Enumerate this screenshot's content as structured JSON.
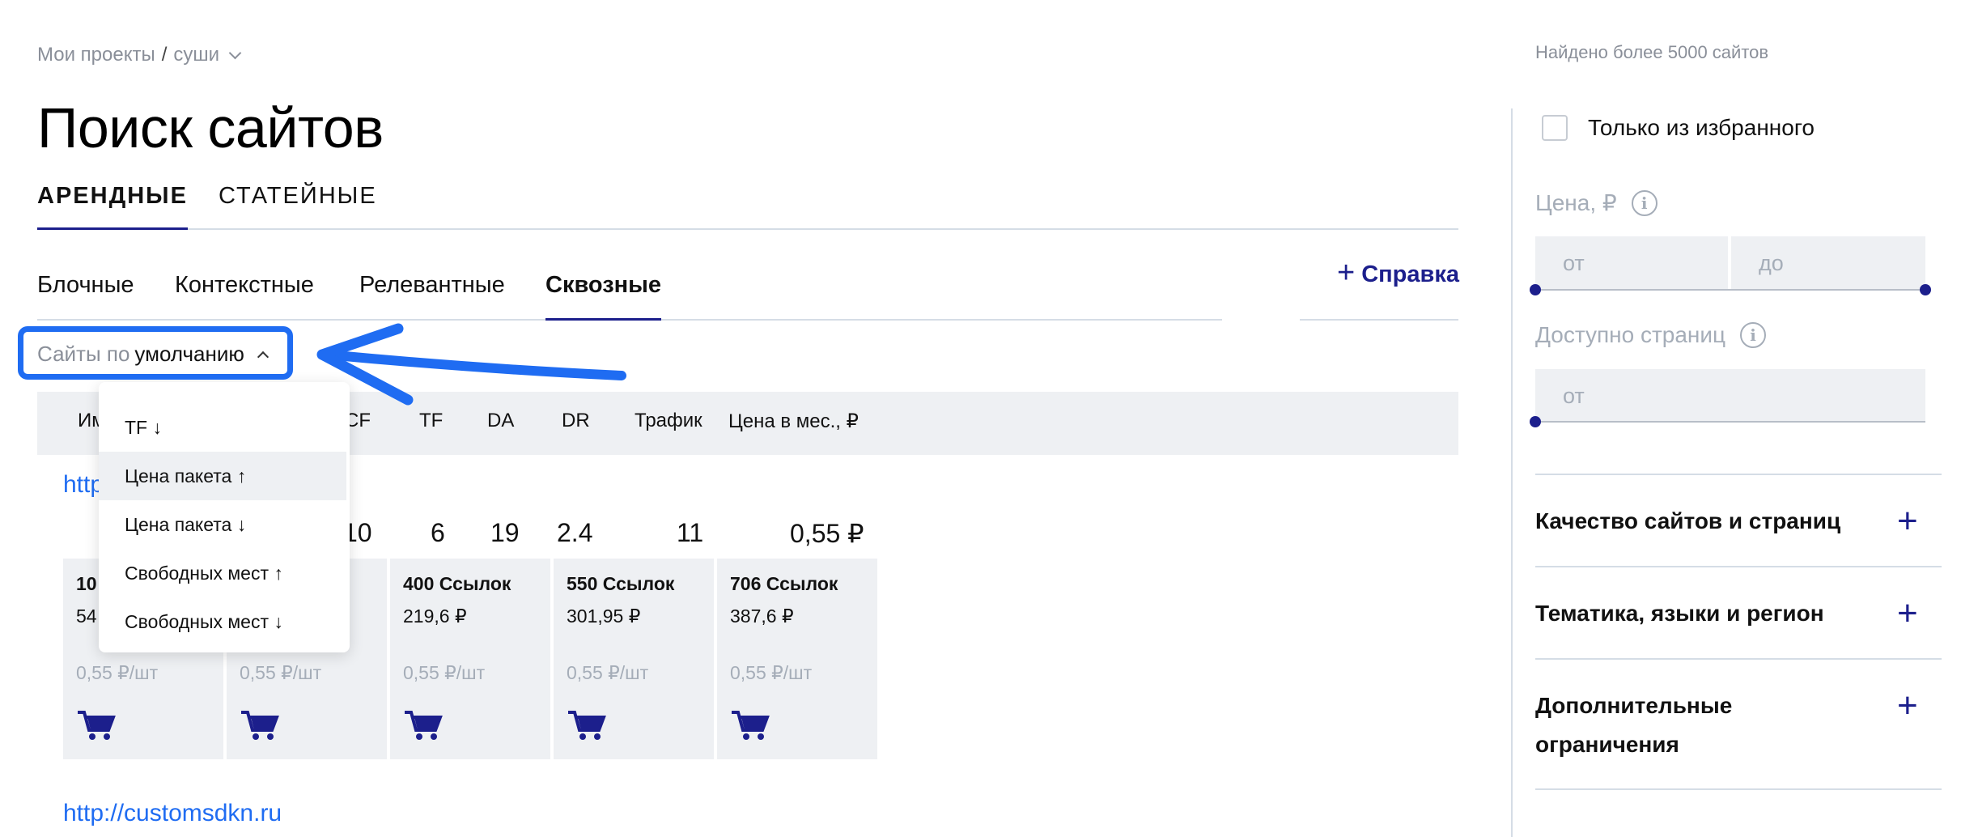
{
  "breadcrumb": {
    "root": "Мои проекты",
    "separator": "/",
    "current": "суши"
  },
  "page": {
    "title": "Поиск сайтов"
  },
  "main_tabs": [
    {
      "label": "АРЕНДНЫЕ",
      "active": true
    },
    {
      "label": "СТАТЕЙНЫЕ",
      "active": false
    }
  ],
  "sub_tabs": [
    {
      "label": "Блочные"
    },
    {
      "label": "Контекстные"
    },
    {
      "label": "Релевантные"
    },
    {
      "label": "Сквозные",
      "active": true
    }
  ],
  "help": {
    "label": "Справка"
  },
  "sort": {
    "prefix": "Сайты по",
    "value": "умолчанию"
  },
  "table_header": {
    "col_partial": "Им",
    "cf": "CF",
    "tf": "TF",
    "da": "DA",
    "dr": "DR",
    "traffic": "Трафик",
    "price": "Цена в мес., ₽"
  },
  "rows": [
    {
      "url_partial": "http",
      "metrics": {
        "cf": "10",
        "tf": "6",
        "da": "19",
        "dr": "2.4",
        "traffic": "11",
        "price": "0,55 ₽"
      },
      "packages": [
        {
          "title": "10",
          "price": "54",
          "unit": "0,55 ₽/шт"
        },
        {
          "title": "",
          "price": "",
          "unit": "0,55 ₽/шт"
        },
        {
          "title": "400 Ссылок",
          "price": "219,6 ₽",
          "unit": "0,55 ₽/шт"
        },
        {
          "title": "550 Ссылок",
          "price": "301,95 ₽",
          "unit": "0,55 ₽/шт"
        },
        {
          "title": "706 Ссылок",
          "price": "387,6 ₽",
          "unit": "0,55 ₽/шт"
        }
      ]
    },
    {
      "url": "http://customsdkn.ru"
    }
  ],
  "dropdown": {
    "items": [
      {
        "label": "TF ↓"
      },
      {
        "label": "Цена пакета ↑",
        "highlighted": true
      },
      {
        "label": "Цена пакета ↓"
      },
      {
        "label": "Свободных мест ↑"
      },
      {
        "label": "Свободных мест ↓"
      }
    ]
  },
  "filters": {
    "found_text": "Найдено более 5000 сайтов",
    "favorites_label": "Только из избранного",
    "favorites_checked": false,
    "price": {
      "label": "Цена, ₽",
      "from_placeholder": "от",
      "to_placeholder": "до"
    },
    "pages": {
      "label": "Доступно страниц",
      "from_placeholder": "от"
    },
    "info_glyph": "i",
    "sections": [
      {
        "title": "Качество сайтов и страниц"
      },
      {
        "title": "Тематика, языки и регион"
      },
      {
        "title_line1": "Дополнительные",
        "title_line2": "ограничения"
      }
    ]
  },
  "colors": {
    "accent": "#1c1f8c",
    "link": "#1f6cf2",
    "highlight_box": "#1f6cf2",
    "muted": "#8a8f99",
    "panel_bg": "#eef0f3"
  },
  "icons": {
    "cart": "cart-icon",
    "plus": "plus-icon",
    "info": "info-icon",
    "chevron": "chevron-icon"
  }
}
